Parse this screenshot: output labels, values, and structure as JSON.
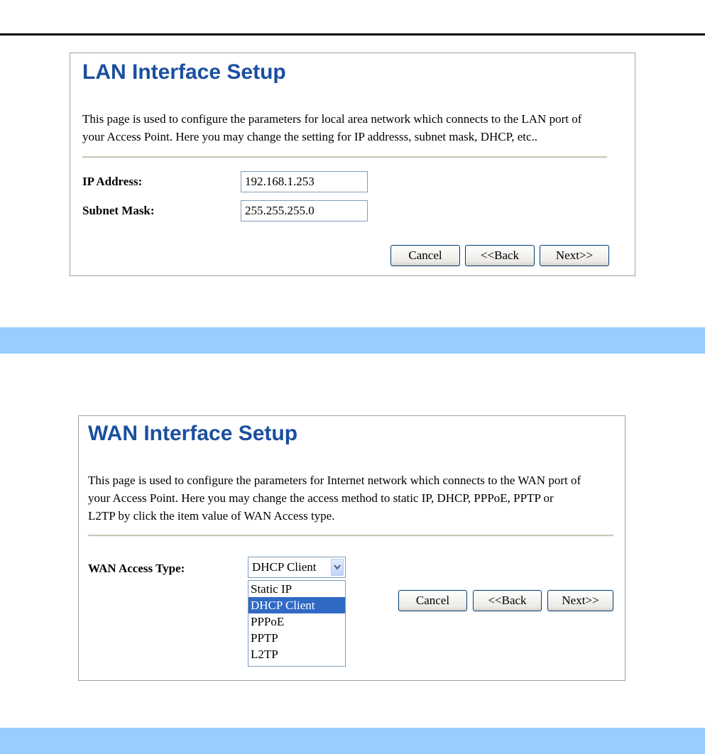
{
  "lan": {
    "title": "LAN Interface Setup",
    "description_line1": "This page is used to configure the parameters for local area network which connects to the LAN port of",
    "description_line2": "your Access Point. Here you may change the setting for IP addresss, subnet mask, DHCP, etc..",
    "ip_label": "IP Address:",
    "ip_value": "192.168.1.253",
    "subnet_label": "Subnet Mask:",
    "subnet_value": "255.255.255.0",
    "cancel_label": "Cancel",
    "back_label": "<<Back",
    "next_label": "Next>>"
  },
  "wan": {
    "title": "WAN Interface Setup",
    "description_line1": "This page is used to configure the parameters for Internet network which connects to the WAN port of",
    "description_line2": "your Access Point. Here you may change the access method to static IP, DHCP, PPPoE, PPTP or",
    "description_line3": "L2TP by click the item value of WAN Access type.",
    "access_type_label": "WAN Access Type:",
    "access_type_selected": "DHCP Client",
    "access_type_options": [
      "Static IP",
      "DHCP Client",
      "PPPoE",
      "PPTP",
      "L2TP"
    ],
    "cancel_label": "Cancel",
    "back_label": "<<Back",
    "next_label": "Next>>"
  },
  "colors": {
    "band": "#99ccff",
    "title": "#1a4fa0",
    "selected_option": "#316ac5"
  },
  "icons": {
    "dropdown_arrow": "chevron-down-icon"
  }
}
